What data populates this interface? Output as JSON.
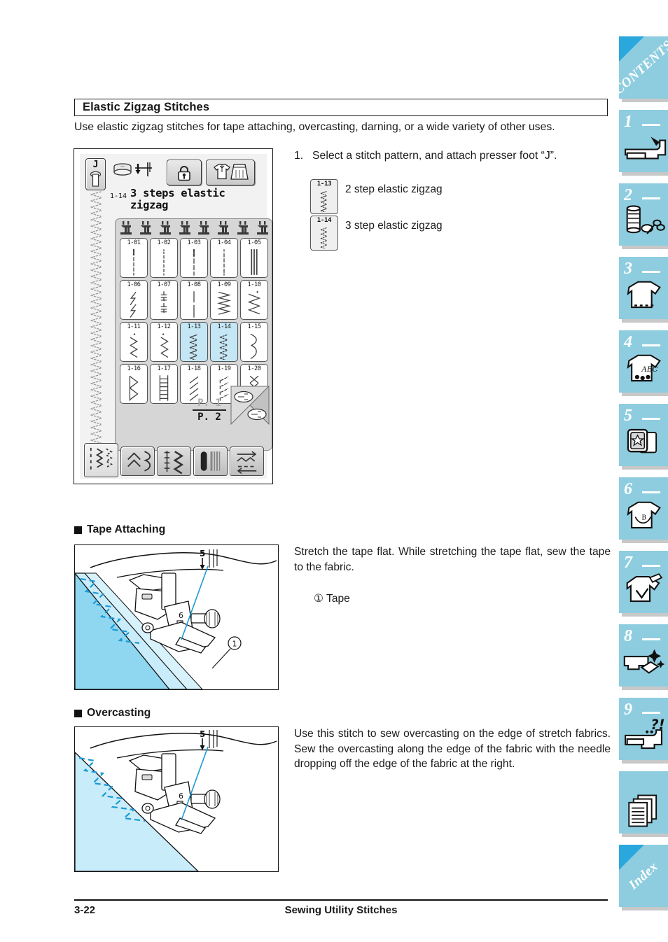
{
  "section": {
    "title": "Elastic Zigzag Stitches",
    "intro": "Use elastic zigzag stitches for tape attaching, overcasting, darning, or a wide variety of other uses."
  },
  "step1": {
    "number": "1.",
    "text": "Select a stitch pattern, and attach presser foot “J”."
  },
  "legend": [
    {
      "code": "1-13",
      "label": "2 step elastic zigzag"
    },
    {
      "code": "1-14",
      "label": "3 step elastic zigzag"
    }
  ],
  "lcd": {
    "presser_foot_label": "J",
    "stitch_number": "1-14",
    "stitch_name": "3 steps elastic\nzigzag",
    "page_prev": "P. 1",
    "page_current": "P. 2",
    "cells": [
      {
        "code": "1-01",
        "glyph": "straight-dashed",
        "selected": false
      },
      {
        "code": "1-02",
        "glyph": "straight-fine-dash",
        "selected": false
      },
      {
        "code": "1-03",
        "glyph": "straight-long-dash",
        "selected": false
      },
      {
        "code": "1-04",
        "glyph": "straight-dot-dash",
        "selected": false
      },
      {
        "code": "1-05",
        "glyph": "triple-straight",
        "selected": false
      },
      {
        "code": "1-06",
        "glyph": "lightning-stretch",
        "selected": false
      },
      {
        "code": "1-07",
        "glyph": "basting-bar",
        "selected": false
      },
      {
        "code": "1-08",
        "glyph": "straight-solid",
        "selected": false
      },
      {
        "code": "1-09",
        "glyph": "zigzag-dense",
        "selected": false
      },
      {
        "code": "1-10",
        "glyph": "zigzag-wide",
        "selected": false
      },
      {
        "code": "1-11",
        "glyph": "zigzag-narrow-left",
        "selected": false
      },
      {
        "code": "1-12",
        "glyph": "zigzag-narrow-right",
        "selected": false
      },
      {
        "code": "1-13",
        "glyph": "two-step-elastic-zigzag",
        "selected": true
      },
      {
        "code": "1-14",
        "glyph": "three-step-elastic-zigzag",
        "selected": true
      },
      {
        "code": "1-15",
        "glyph": "stretch-wave",
        "selected": false
      },
      {
        "code": "1-16",
        "glyph": "overcast-triangle",
        "selected": false
      },
      {
        "code": "1-17",
        "glyph": "ladder-overcast",
        "selected": false
      },
      {
        "code": "1-18",
        "glyph": "slant-overcast",
        "selected": false
      },
      {
        "code": "1-19",
        "glyph": "slant-dash-overcast",
        "selected": false
      },
      {
        "code": "1-20",
        "glyph": "cross-overcast",
        "selected": false
      }
    ],
    "category_tabs": [
      {
        "name": "utility-stitches-tab",
        "active": true
      },
      {
        "name": "decorative-stitches-tab",
        "active": false
      },
      {
        "name": "satin-stitches-tab",
        "active": false
      },
      {
        "name": "buttonhole-stitches-tab",
        "active": false
      },
      {
        "name": "direction-stitches-tab",
        "active": false
      }
    ],
    "top_buttons": [
      {
        "name": "bobbin-needle-indicator"
      },
      {
        "name": "key-lock-button"
      },
      {
        "name": "garment-select-button"
      }
    ]
  },
  "tape_attaching": {
    "heading": "Tape Attaching",
    "text": "Stretch the tape flat. While stretching the tape flat, sew the tape to the fabric.",
    "callout": "①  Tape",
    "figure_labels": {
      "dial": "5",
      "foot": "6",
      "marker": "①"
    }
  },
  "overcasting": {
    "heading": "Overcasting",
    "text": "Use this stitch to sew overcasting on the edge of stretch fabrics. Sew the overcasting along the edge of the fabric with the needle dropping off the edge of the fabric at the right.",
    "figure_labels": {
      "dial": "5",
      "foot": "6"
    }
  },
  "sidebar": {
    "tabs": [
      {
        "name": "contents-tab",
        "label": "CONTENTS",
        "number": "",
        "icon": "corner-tab"
      },
      {
        "name": "chapter-1-tab",
        "label": "",
        "number": "1",
        "icon": "sewing-machine-icon"
      },
      {
        "name": "chapter-2-tab",
        "label": "",
        "number": "2",
        "icon": "thread-spool-icon"
      },
      {
        "name": "chapter-3-tab",
        "label": "",
        "number": "3",
        "icon": "tshirt-stitch-icon"
      },
      {
        "name": "chapter-4-tab",
        "label": "",
        "number": "4",
        "icon": "tshirt-abc-icon"
      },
      {
        "name": "chapter-5-tab",
        "label": "",
        "number": "5",
        "icon": "embroidery-card-icon"
      },
      {
        "name": "chapter-6-tab",
        "label": "",
        "number": "6",
        "icon": "tshirt-monogram-icon"
      },
      {
        "name": "chapter-7-tab",
        "label": "",
        "number": "7",
        "icon": "tshirt-applique-icon"
      },
      {
        "name": "chapter-8-tab",
        "label": "",
        "number": "8",
        "icon": "machine-clean-icon"
      },
      {
        "name": "chapter-9-tab",
        "label": "",
        "number": "9",
        "icon": "machine-troubleshoot-icon"
      },
      {
        "name": "appendix-tab",
        "label": "",
        "number": "",
        "icon": "pages-icon"
      },
      {
        "name": "index-tab",
        "label": "Index",
        "number": "",
        "icon": "corner-tab"
      }
    ]
  },
  "footer": {
    "page_number": "3-22",
    "title": "Sewing Utility Stitches"
  },
  "colors": {
    "tab_blue": "#8ecddf",
    "tab_corner_blue": "#2aa8dd",
    "selected_cell": "#c5e7f5",
    "fabric_cyan": "#8fd7f0",
    "stitch_line": "#1b9ad6"
  }
}
